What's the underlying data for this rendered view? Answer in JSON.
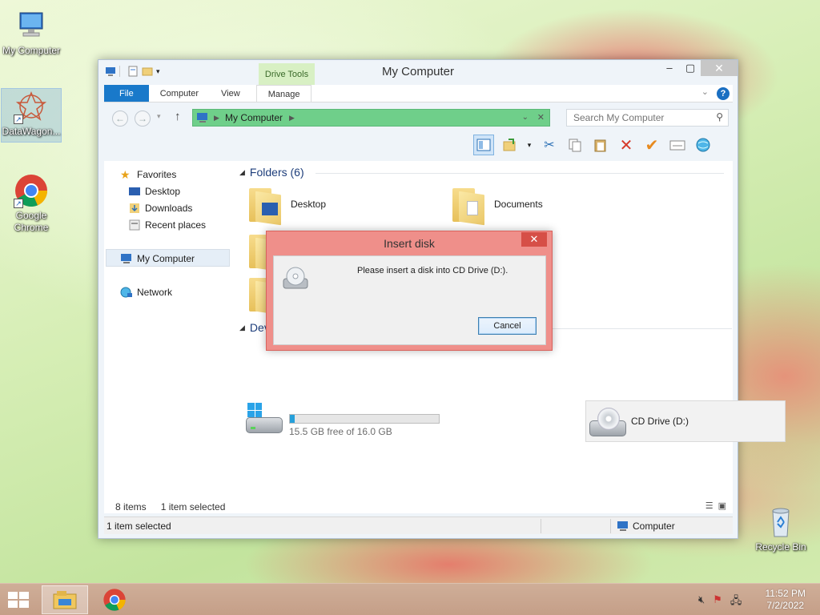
{
  "desktop": {
    "icons": [
      {
        "label": "My Computer"
      },
      {
        "label": "DataWagon..."
      },
      {
        "label": "Google Chrome"
      },
      {
        "label": "Recycle Bin"
      }
    ]
  },
  "window": {
    "title": "My Computer",
    "contextual_tab": "Drive Tools",
    "ribbon_tabs": [
      "File",
      "Computer",
      "View",
      "Manage"
    ],
    "address": "My Computer",
    "search_placeholder": "Search My Computer",
    "nav": {
      "favorites": "Favorites",
      "desktop": "Desktop",
      "downloads": "Downloads",
      "recent": "Recent places",
      "computer": "My Computer",
      "network": "Network"
    },
    "folders_header": "Folders (6)",
    "folders": [
      {
        "label": "Desktop"
      },
      {
        "label": "Documents"
      }
    ],
    "devices_header": "Dev",
    "drives": [
      {
        "label": "",
        "free": "15.5 GB free of 16.0 GB",
        "used_fraction": 0.03
      },
      {
        "label": "CD Drive (D:)"
      }
    ],
    "item_count": "8 items",
    "selection": "1 item selected",
    "status_left": "1 item selected",
    "status_right": "Computer"
  },
  "dialog": {
    "title": "Insert disk",
    "message": "Please insert a disk into CD Drive (D:).",
    "cancel": "Cancel",
    "close": "✕"
  },
  "taskbar": {
    "time": "11:52 PM",
    "date": "7/2/2022"
  },
  "colors": {
    "accent": "#1979ca",
    "address_highlight": "#6fcf8a",
    "dialog_frame": "#ef8f8a",
    "taskbar": "#c9a38c"
  }
}
